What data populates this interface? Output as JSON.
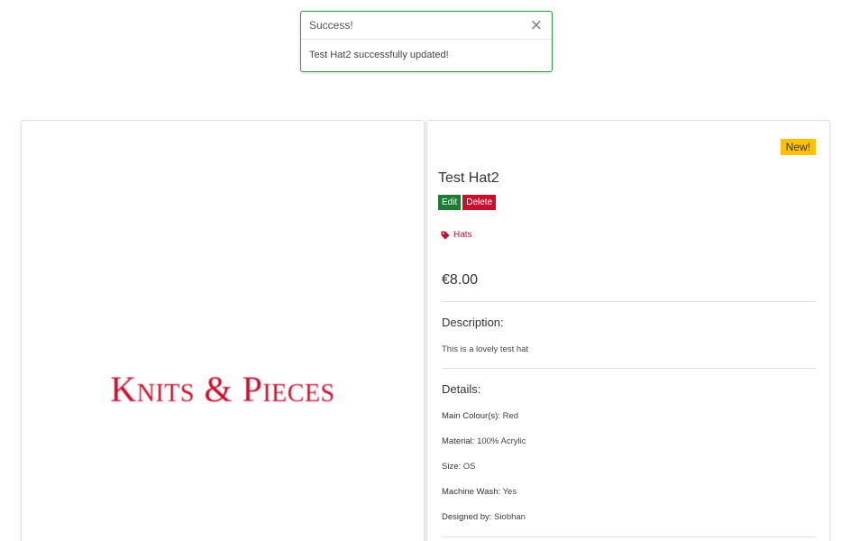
{
  "toast": {
    "title": "Success!",
    "close_glyph": "×",
    "message": "Test Hat2 successfully updated!",
    "border_color": "#2e9b3e"
  },
  "image_card": {
    "logo_text": "Knits & Pieces",
    "logo_color": "#c8102e"
  },
  "product": {
    "badge": "New!",
    "name": "Test Hat2",
    "edit_label": "Edit",
    "delete_label": "Delete",
    "category_icon": "tag-icon",
    "category": "Hats",
    "price": "€8.00",
    "description_title": "Description:",
    "description": "This is a lovely test hat",
    "details_title": "Details:",
    "details": [
      {
        "label": "Main Colour(s):",
        "value": "Red"
      },
      {
        "label": "Material:",
        "value": "100% Acrylic"
      },
      {
        "label": "Size:",
        "value": "OS"
      },
      {
        "label": "Machine Wash:",
        "value": "Yes"
      },
      {
        "label": "Designed by:",
        "value": "Siobhan"
      }
    ]
  },
  "colors": {
    "accent_red": "#c8102e",
    "edit_green": "#1f7a35",
    "badge_yellow": "#ffc107"
  }
}
